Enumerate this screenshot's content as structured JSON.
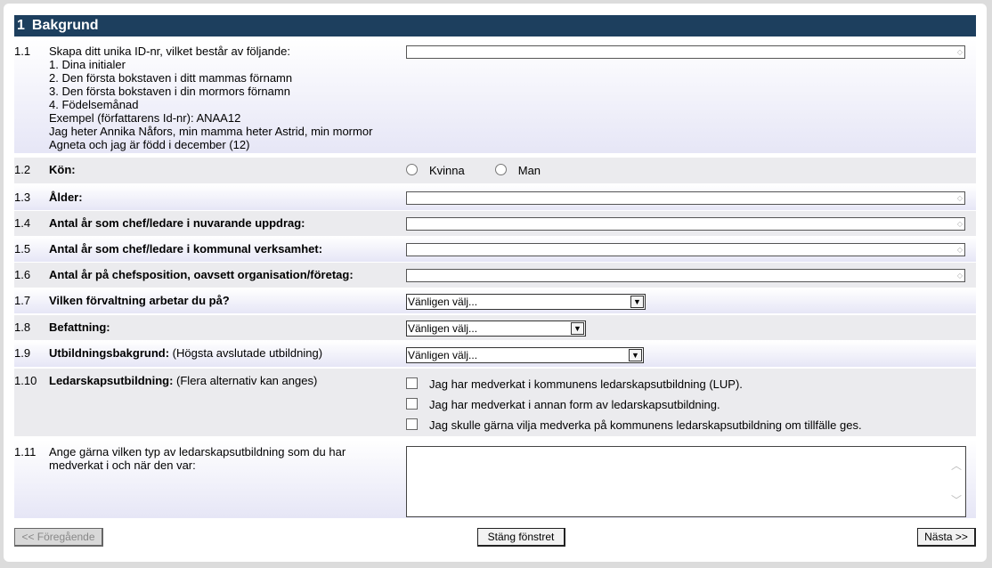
{
  "section": {
    "number": "1",
    "title": "Bakgrund"
  },
  "q1_1": {
    "num": "1.1",
    "lines": [
      "Skapa ditt unika ID-nr, vilket består av följande:",
      "1. Dina initialer",
      "2. Den första bokstaven i ditt mammas förnamn",
      "3. Den första bokstaven i din mormors förnamn",
      "4. Födelsemånad",
      "Exempel (författarens Id-nr): ANAA12",
      "Jag heter Annika Nåfors, min mamma heter Astrid, min mormor",
      "Agneta och jag är född i december (12)"
    ],
    "value": ""
  },
  "q1_2": {
    "num": "1.2",
    "label": "Kön:",
    "options": [
      "Kvinna",
      "Man"
    ]
  },
  "q1_3": {
    "num": "1.3",
    "label": "Ålder:",
    "value": ""
  },
  "q1_4": {
    "num": "1.4",
    "label": "Antal år som chef/ledare i nuvarande uppdrag:",
    "value": ""
  },
  "q1_5": {
    "num": "1.5",
    "label": "Antal år som chef/ledare i kommunal verksamhet:",
    "value": ""
  },
  "q1_6": {
    "num": "1.6",
    "label": "Antal år på chefsposition, oavsett organisation/företag:",
    "value": ""
  },
  "q1_7": {
    "num": "1.7",
    "label": "Vilken förvaltning arbetar du på?",
    "selected": "Vänligen välj..."
  },
  "q1_8": {
    "num": "1.8",
    "label": "Befattning:",
    "selected": "Vänligen välj..."
  },
  "q1_9": {
    "num": "1.9",
    "label": "Utbildningsbakgrund:",
    "note": "(Högsta avslutade utbildning)",
    "selected": "Vänligen välj..."
  },
  "q1_10": {
    "num": "1.10",
    "label": "Ledarskapsutbildning:",
    "note": "(Flera alternativ kan anges)",
    "options": [
      "Jag har medverkat i kommunens ledarskapsutbildning (LUP).",
      "Jag har medverkat i annan form av ledarskapsutbildning.",
      "Jag skulle gärna vilja medverka på kommunens ledarskapsutbildning om tillfälle ges."
    ]
  },
  "q1_11": {
    "num": "1.11",
    "lines": [
      "Ange gärna vilken typ av ledarskapsutbildning som du har",
      "medverkat i och när den var:"
    ],
    "value": ""
  },
  "buttons": {
    "prev": "<< Föregående",
    "close": "Stäng fönstret",
    "next": "Nästa >>"
  }
}
